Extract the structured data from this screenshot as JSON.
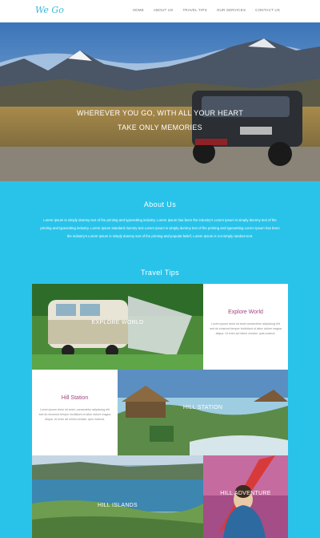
{
  "header": {
    "logo": "We Go",
    "nav": [
      "HOME",
      "ABOUT US",
      "TRAVEL TIPS",
      "OUR SERVICES",
      "CONTACT US"
    ]
  },
  "hero": {
    "line1": "WHEREVER YOU GO, WITH ALL YOUR HEART",
    "line2": "TAKE ONLY MEMORIES"
  },
  "about": {
    "title": "About Us",
    "text": "Lorem Ipsum is simply dummy text of the printing and typesetting industry. Lorem Ipsum has been the industry's Lorem Ipsum is simply dummy text of the printing and typesetting industry. Lorem Ipsum standard dummy text Lorem Ipsum is simply dummy text of the printing and typesetting Lorem Ipsum has been the industry's Lorem Ipsum is simply dummy text of the printing and popular belief, Lorem Ipsum is not simply random text."
  },
  "tips": {
    "title": "Travel Tips",
    "tiles": [
      {
        "photo_label": "EXPLORE WORLD",
        "card_title": "Explore World",
        "card_text": "Lorem ipsum dolor sit amet consectetur adipiscing elit sed do eiusmod tempor incididunt ut labor dolore magna aliqua. Ut enim ad minim veniam, quis nostrud."
      },
      {
        "photo_label": "HILL STATION",
        "card_title": "Hill Station",
        "card_text": "Lorem ipsum dolor sit amet, consectetur adipiscing elit sed do eiusmod tempor incididunt ut labor dolore magna aliqua. Ut enim ad minim veniam, quis nostrud."
      },
      {
        "photo_label": "HILL ISLANDS"
      },
      {
        "photo_label": "HILL ADVENTURE"
      }
    ]
  },
  "colors": {
    "accent": "#29c3ea",
    "card_title": "#a2467e",
    "logo": "#3cb8d8"
  }
}
